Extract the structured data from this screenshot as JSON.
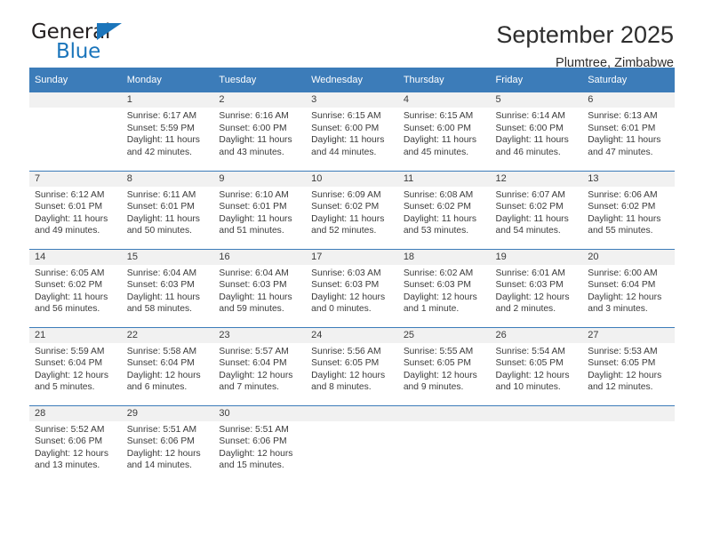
{
  "brand": {
    "general": "General",
    "blue": "Blue",
    "triangle_color": "#1b75bb"
  },
  "header": {
    "title": "September 2025",
    "subtitle": "Plumtree, Zimbabwe"
  },
  "colors": {
    "header_blue": "#3c7cb9",
    "row_shade": "#f1f1f1",
    "text": "#3b3b3b"
  },
  "calendar": {
    "weekday_headers": [
      "Sunday",
      "Monday",
      "Tuesday",
      "Wednesday",
      "Thursday",
      "Friday",
      "Saturday"
    ],
    "labels": {
      "sunrise": "Sunrise:",
      "sunset": "Sunset:",
      "daylight": "Daylight:"
    },
    "weeks": [
      [
        {
          "day": ""
        },
        {
          "day": "1",
          "sunrise": "Sunrise: 6:17 AM",
          "sunset": "Sunset: 5:59 PM",
          "daylight_l1": "Daylight: 11 hours",
          "daylight_l2": "and 42 minutes."
        },
        {
          "day": "2",
          "sunrise": "Sunrise: 6:16 AM",
          "sunset": "Sunset: 6:00 PM",
          "daylight_l1": "Daylight: 11 hours",
          "daylight_l2": "and 43 minutes."
        },
        {
          "day": "3",
          "sunrise": "Sunrise: 6:15 AM",
          "sunset": "Sunset: 6:00 PM",
          "daylight_l1": "Daylight: 11 hours",
          "daylight_l2": "and 44 minutes."
        },
        {
          "day": "4",
          "sunrise": "Sunrise: 6:15 AM",
          "sunset": "Sunset: 6:00 PM",
          "daylight_l1": "Daylight: 11 hours",
          "daylight_l2": "and 45 minutes."
        },
        {
          "day": "5",
          "sunrise": "Sunrise: 6:14 AM",
          "sunset": "Sunset: 6:00 PM",
          "daylight_l1": "Daylight: 11 hours",
          "daylight_l2": "and 46 minutes."
        },
        {
          "day": "6",
          "sunrise": "Sunrise: 6:13 AM",
          "sunset": "Sunset: 6:01 PM",
          "daylight_l1": "Daylight: 11 hours",
          "daylight_l2": "and 47 minutes."
        }
      ],
      [
        {
          "day": "7",
          "sunrise": "Sunrise: 6:12 AM",
          "sunset": "Sunset: 6:01 PM",
          "daylight_l1": "Daylight: 11 hours",
          "daylight_l2": "and 49 minutes."
        },
        {
          "day": "8",
          "sunrise": "Sunrise: 6:11 AM",
          "sunset": "Sunset: 6:01 PM",
          "daylight_l1": "Daylight: 11 hours",
          "daylight_l2": "and 50 minutes."
        },
        {
          "day": "9",
          "sunrise": "Sunrise: 6:10 AM",
          "sunset": "Sunset: 6:01 PM",
          "daylight_l1": "Daylight: 11 hours",
          "daylight_l2": "and 51 minutes."
        },
        {
          "day": "10",
          "sunrise": "Sunrise: 6:09 AM",
          "sunset": "Sunset: 6:02 PM",
          "daylight_l1": "Daylight: 11 hours",
          "daylight_l2": "and 52 minutes."
        },
        {
          "day": "11",
          "sunrise": "Sunrise: 6:08 AM",
          "sunset": "Sunset: 6:02 PM",
          "daylight_l1": "Daylight: 11 hours",
          "daylight_l2": "and 53 minutes."
        },
        {
          "day": "12",
          "sunrise": "Sunrise: 6:07 AM",
          "sunset": "Sunset: 6:02 PM",
          "daylight_l1": "Daylight: 11 hours",
          "daylight_l2": "and 54 minutes."
        },
        {
          "day": "13",
          "sunrise": "Sunrise: 6:06 AM",
          "sunset": "Sunset: 6:02 PM",
          "daylight_l1": "Daylight: 11 hours",
          "daylight_l2": "and 55 minutes."
        }
      ],
      [
        {
          "day": "14",
          "sunrise": "Sunrise: 6:05 AM",
          "sunset": "Sunset: 6:02 PM",
          "daylight_l1": "Daylight: 11 hours",
          "daylight_l2": "and 56 minutes."
        },
        {
          "day": "15",
          "sunrise": "Sunrise: 6:04 AM",
          "sunset": "Sunset: 6:03 PM",
          "daylight_l1": "Daylight: 11 hours",
          "daylight_l2": "and 58 minutes."
        },
        {
          "day": "16",
          "sunrise": "Sunrise: 6:04 AM",
          "sunset": "Sunset: 6:03 PM",
          "daylight_l1": "Daylight: 11 hours",
          "daylight_l2": "and 59 minutes."
        },
        {
          "day": "17",
          "sunrise": "Sunrise: 6:03 AM",
          "sunset": "Sunset: 6:03 PM",
          "daylight_l1": "Daylight: 12 hours",
          "daylight_l2": "and 0 minutes."
        },
        {
          "day": "18",
          "sunrise": "Sunrise: 6:02 AM",
          "sunset": "Sunset: 6:03 PM",
          "daylight_l1": "Daylight: 12 hours",
          "daylight_l2": "and 1 minute."
        },
        {
          "day": "19",
          "sunrise": "Sunrise: 6:01 AM",
          "sunset": "Sunset: 6:03 PM",
          "daylight_l1": "Daylight: 12 hours",
          "daylight_l2": "and 2 minutes."
        },
        {
          "day": "20",
          "sunrise": "Sunrise: 6:00 AM",
          "sunset": "Sunset: 6:04 PM",
          "daylight_l1": "Daylight: 12 hours",
          "daylight_l2": "and 3 minutes."
        }
      ],
      [
        {
          "day": "21",
          "sunrise": "Sunrise: 5:59 AM",
          "sunset": "Sunset: 6:04 PM",
          "daylight_l1": "Daylight: 12 hours",
          "daylight_l2": "and 5 minutes."
        },
        {
          "day": "22",
          "sunrise": "Sunrise: 5:58 AM",
          "sunset": "Sunset: 6:04 PM",
          "daylight_l1": "Daylight: 12 hours",
          "daylight_l2": "and 6 minutes."
        },
        {
          "day": "23",
          "sunrise": "Sunrise: 5:57 AM",
          "sunset": "Sunset: 6:04 PM",
          "daylight_l1": "Daylight: 12 hours",
          "daylight_l2": "and 7 minutes."
        },
        {
          "day": "24",
          "sunrise": "Sunrise: 5:56 AM",
          "sunset": "Sunset: 6:05 PM",
          "daylight_l1": "Daylight: 12 hours",
          "daylight_l2": "and 8 minutes."
        },
        {
          "day": "25",
          "sunrise": "Sunrise: 5:55 AM",
          "sunset": "Sunset: 6:05 PM",
          "daylight_l1": "Daylight: 12 hours",
          "daylight_l2": "and 9 minutes."
        },
        {
          "day": "26",
          "sunrise": "Sunrise: 5:54 AM",
          "sunset": "Sunset: 6:05 PM",
          "daylight_l1": "Daylight: 12 hours",
          "daylight_l2": "and 10 minutes."
        },
        {
          "day": "27",
          "sunrise": "Sunrise: 5:53 AM",
          "sunset": "Sunset: 6:05 PM",
          "daylight_l1": "Daylight: 12 hours",
          "daylight_l2": "and 12 minutes."
        }
      ],
      [
        {
          "day": "28",
          "sunrise": "Sunrise: 5:52 AM",
          "sunset": "Sunset: 6:06 PM",
          "daylight_l1": "Daylight: 12 hours",
          "daylight_l2": "and 13 minutes."
        },
        {
          "day": "29",
          "sunrise": "Sunrise: 5:51 AM",
          "sunset": "Sunset: 6:06 PM",
          "daylight_l1": "Daylight: 12 hours",
          "daylight_l2": "and 14 minutes."
        },
        {
          "day": "30",
          "sunrise": "Sunrise: 5:51 AM",
          "sunset": "Sunset: 6:06 PM",
          "daylight_l1": "Daylight: 12 hours",
          "daylight_l2": "and 15 minutes."
        },
        {
          "day": ""
        },
        {
          "day": ""
        },
        {
          "day": ""
        },
        {
          "day": ""
        }
      ]
    ]
  }
}
